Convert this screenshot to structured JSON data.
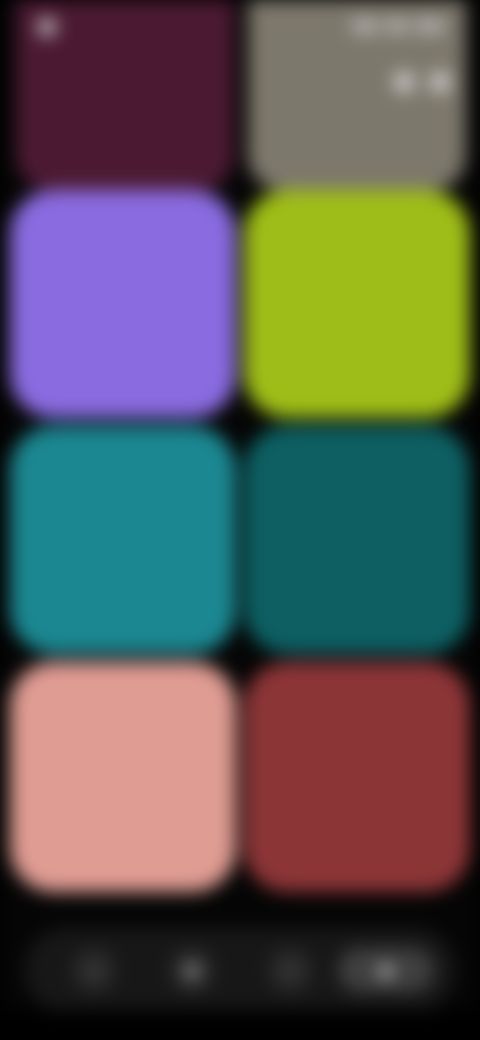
{
  "header": {
    "title": ""
  },
  "tiles": [
    {
      "label": "",
      "subtitle": "",
      "color": "#8a6be0"
    },
    {
      "label": "",
      "subtitle": "",
      "color": "#9fbd18"
    },
    {
      "label": "",
      "subtitle": "",
      "color": "#1b8791"
    },
    {
      "label": "",
      "subtitle": "",
      "color": "#0d5f62"
    },
    {
      "label": "",
      "subtitle": "",
      "color": "#df9c93"
    },
    {
      "label": "",
      "subtitle": "",
      "color": "#8c3537"
    }
  ],
  "top_tiles": [
    {
      "color": "#4b1a32"
    },
    {
      "color": "#7d786c"
    }
  ],
  "nav": {
    "items": [
      {
        "icon": "home-icon"
      },
      {
        "icon": "browse-icon"
      },
      {
        "icon": "search-icon"
      },
      {
        "icon": "library-icon"
      }
    ]
  }
}
